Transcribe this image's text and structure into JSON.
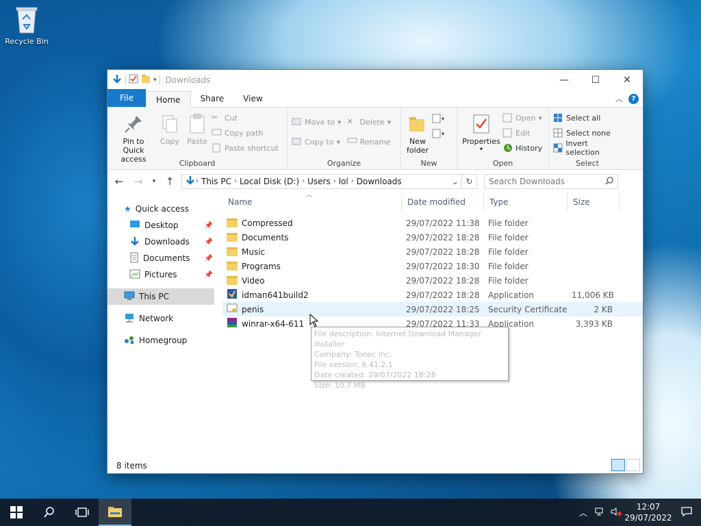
{
  "desktop": {
    "recycle_bin": "Recycle Bin"
  },
  "window": {
    "title": "Downloads",
    "tabs": {
      "file": "File",
      "home": "Home",
      "share": "Share",
      "view": "View"
    }
  },
  "ribbon": {
    "clipboard": {
      "label": "Clipboard",
      "pin": "Pin to Quick access",
      "copy": "Copy",
      "paste": "Paste",
      "cut": "Cut",
      "copy_path": "Copy path",
      "paste_shortcut": "Paste shortcut"
    },
    "organize": {
      "label": "Organize",
      "move_to": "Move to",
      "copy_to": "Copy to",
      "delete": "Delete",
      "rename": "Rename"
    },
    "new": {
      "label": "New",
      "new_folder": "New folder"
    },
    "open": {
      "label": "Open",
      "properties": "Properties",
      "open": "Open",
      "edit": "Edit",
      "history": "History"
    },
    "select": {
      "label": "Select",
      "select_all": "Select all",
      "select_none": "Select none",
      "invert": "Invert selection"
    }
  },
  "address": {
    "crumbs": [
      "This PC",
      "Local Disk (D:)",
      "Users",
      "lol",
      "Downloads"
    ],
    "search_placeholder": "Search Downloads"
  },
  "nav": {
    "quick_access": "Quick access",
    "desktop": "Desktop",
    "downloads": "Downloads",
    "documents": "Documents",
    "pictures": "Pictures",
    "this_pc": "This PC",
    "network": "Network",
    "homegroup": "Homegroup"
  },
  "columns": {
    "name": "Name",
    "date": "Date modified",
    "type": "Type",
    "size": "Size"
  },
  "files": [
    {
      "name": "Compressed",
      "date": "29/07/2022 11:38",
      "type": "File folder",
      "size": ""
    },
    {
      "name": "Documents",
      "date": "29/07/2022 18:28",
      "type": "File folder",
      "size": ""
    },
    {
      "name": "Music",
      "date": "29/07/2022 18:28",
      "type": "File folder",
      "size": ""
    },
    {
      "name": "Programs",
      "date": "29/07/2022 18:30",
      "type": "File folder",
      "size": ""
    },
    {
      "name": "Video",
      "date": "29/07/2022 18:28",
      "type": "File folder",
      "size": ""
    },
    {
      "name": "idman641build2",
      "date": "29/07/2022 18:28",
      "type": "Application",
      "size": "11,006 KB"
    },
    {
      "name": "penis",
      "date": "29/07/2022 18:25",
      "type": "Security Certificate",
      "size": "2 KB"
    },
    {
      "name": "winrar-x64-611",
      "date": "29/07/2022 11:33",
      "type": "Application",
      "size": "3,393 KB"
    }
  ],
  "tooltip": {
    "line1": "File description: Internet Download Manager installer",
    "line2": "Company: Tonec Inc.",
    "line3": "File version: 6.41.2.1",
    "line4": "Date created: 29/07/2022 18:28",
    "line5": "Size: 10.7 MB"
  },
  "status": {
    "items": "8 items"
  },
  "taskbar": {
    "time": "12:07",
    "date": "29/07/2022"
  }
}
